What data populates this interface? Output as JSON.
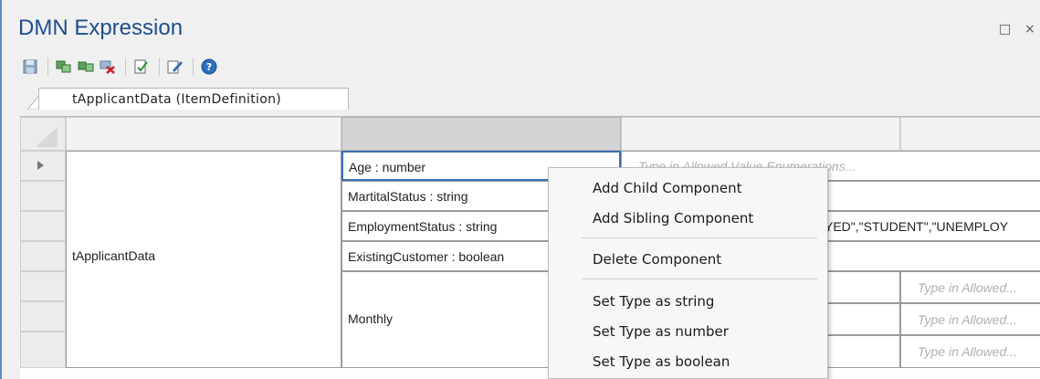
{
  "window": {
    "title": "DMN Expression",
    "restore_glyph": "□",
    "close_glyph": "×"
  },
  "toolbar": {
    "icons": [
      "save-icon",
      "add-child-icon",
      "add-sibling-icon",
      "delete-icon",
      "validate-icon",
      "edit-icon",
      "help-icon"
    ]
  },
  "tabs": [
    {
      "label": "tApplicantData (ItemDefinition)"
    }
  ],
  "grid": {
    "root_label": "tApplicantData",
    "rows": [
      {
        "component": "Age : number",
        "allowed_values": "Type in Allowed Value Enumerations..."
      },
      {
        "component": "MartitalStatus : string",
        "allowed_values": ""
      },
      {
        "component": "EmploymentStatus : string",
        "allowed_values": "YED\",\"STUDENT\",\"UNEMPLOY"
      },
      {
        "component": "ExistingCustomer : boolean",
        "allowed_values": ""
      }
    ],
    "group_label": "Monthly",
    "sub_rows": [
      {
        "allowed_values": "Type in Allowed..."
      },
      {
        "allowed_values": "Type in Allowed..."
      },
      {
        "allowed_values": "Type in Allowed..."
      }
    ]
  },
  "context_menu": {
    "items": [
      {
        "label": "Add Child Component"
      },
      {
        "label": "Add Sibling Component"
      },
      {
        "label": "Delete Component"
      },
      {
        "label": "Set Type as string"
      },
      {
        "label": "Set Type as number"
      },
      {
        "label": "Set Type as boolean"
      }
    ]
  },
  "colors": {
    "accent": "#1f4e8c",
    "selection_border": "#3c6fb4"
  }
}
